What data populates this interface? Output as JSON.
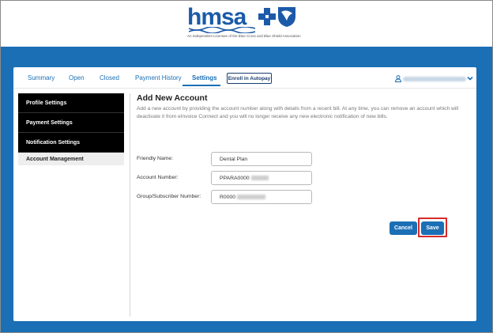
{
  "brand": {
    "logo_text": "hmsa",
    "tagline": "An Independent Licensee of the Blue Cross and Blue Shield Association",
    "colors": {
      "primary": "#1b5aa8",
      "background": "#1a6fb5"
    }
  },
  "tabs": [
    {
      "label": "Summary",
      "active": false
    },
    {
      "label": "Open",
      "active": false
    },
    {
      "label": "Closed",
      "active": false
    },
    {
      "label": "Payment History",
      "active": false
    },
    {
      "label": "Settings",
      "active": true
    }
  ],
  "enroll_button": "Enroll in Autopay",
  "account_menu": {
    "user_icon": "user-icon",
    "chevron_icon": "chevron-down-icon"
  },
  "sidebar": {
    "items": [
      {
        "label": "Profile Settings"
      },
      {
        "label": "Payment Settings"
      },
      {
        "label": "Notification Settings"
      },
      {
        "label": "Account Management"
      }
    ]
  },
  "form": {
    "title": "Add New Account",
    "description": "Add a new account by providing the account number along with details from a recent bill. At any time, you can remove an account which will deactivate it from eInvoice Connect and you will no longer receive any new electronic notification of new bills.",
    "fields": [
      {
        "label": "Friendly Name:",
        "value": "Dental Plan"
      },
      {
        "label": "Account Number:",
        "value": "PPARA0000"
      },
      {
        "label": "Group/Subscriber Number:",
        "value": "R0000"
      }
    ],
    "cancel_label": "Cancel",
    "save_label": "Save"
  }
}
